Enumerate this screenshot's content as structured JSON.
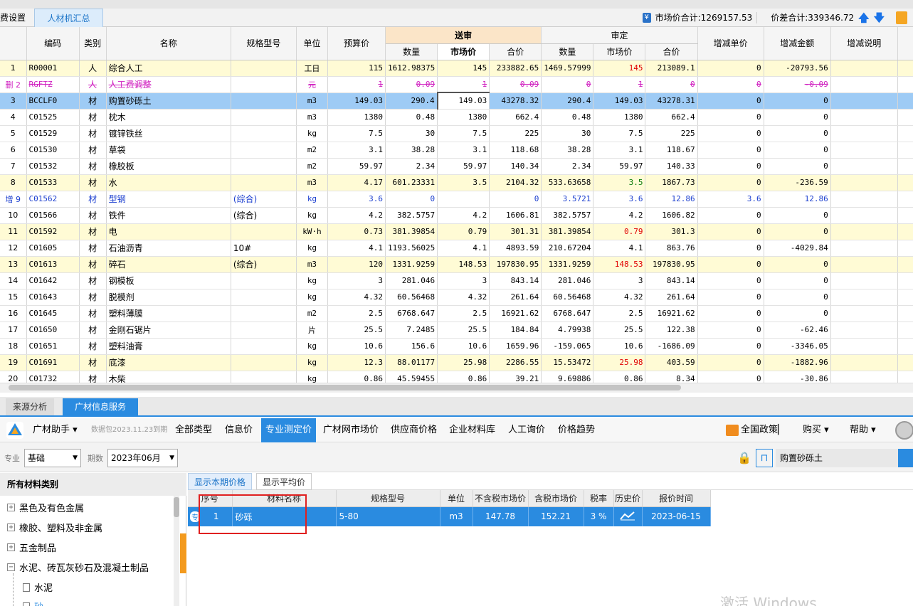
{
  "top_tabs": {
    "fees": "费设置",
    "summary": "人材机汇总"
  },
  "totals": {
    "market_total_label": "市场价合计:1269157.53",
    "price_diff_label": "价差合计:339346.72"
  },
  "grid": {
    "headers": {
      "code": "编码",
      "category": "类别",
      "name": "名称",
      "spec": "规格型号",
      "unit": "单位",
      "budget_price": "预算价",
      "songshen": "送审",
      "shending": "审定",
      "qty": "数量",
      "market_price": "市场价",
      "total": "合价",
      "delta_unit": "增减单价",
      "delta_amount": "增减金额",
      "delta_note": "增减说明"
    },
    "rows": [
      {
        "idx": "1",
        "code": "R00001",
        "cat": "人",
        "name": "综合人工",
        "spec": "",
        "unit": "工日",
        "budget": "115",
        "s_qty": "1612.98375",
        "s_mkt": "145",
        "s_total": "233882.65",
        "d_qty": "1469.57999",
        "d_mkt": "145",
        "d_total": "213089.1",
        "du": "0",
        "da": "-20793.56"
      },
      {
        "idx": "删 2",
        "code": "RGFTZ",
        "cat": "人",
        "name": "人工费调整",
        "spec": "",
        "unit": "元",
        "budget": "1",
        "s_qty": "0.09",
        "s_mkt": "1",
        "s_total": "0.09",
        "d_qty": "0",
        "d_mkt": "1",
        "d_total": "0",
        "du": "0",
        "da": "-0.09"
      },
      {
        "idx": "3",
        "code": "BCCLF0",
        "cat": "材",
        "name": "购置砂砾土",
        "spec": "",
        "unit": "m3",
        "budget": "149.03",
        "s_qty": "290.4",
        "s_mkt": "149.03",
        "s_total": "43278.32",
        "d_qty": "290.4",
        "d_mkt": "149.03",
        "d_total": "43278.31",
        "du": "0",
        "da": "0"
      },
      {
        "idx": "4",
        "code": "C01525",
        "cat": "材",
        "name": "枕木",
        "spec": "",
        "unit": "m3",
        "budget": "1380",
        "s_qty": "0.48",
        "s_mkt": "1380",
        "s_total": "662.4",
        "d_qty": "0.48",
        "d_mkt": "1380",
        "d_total": "662.4",
        "du": "0",
        "da": "0"
      },
      {
        "idx": "5",
        "code": "C01529",
        "cat": "材",
        "name": "镀锌铁丝",
        "spec": "",
        "unit": "kg",
        "budget": "7.5",
        "s_qty": "30",
        "s_mkt": "7.5",
        "s_total": "225",
        "d_qty": "30",
        "d_mkt": "7.5",
        "d_total": "225",
        "du": "0",
        "da": "0"
      },
      {
        "idx": "6",
        "code": "C01530",
        "cat": "材",
        "name": "草袋",
        "spec": "",
        "unit": "m2",
        "budget": "3.1",
        "s_qty": "38.28",
        "s_mkt": "3.1",
        "s_total": "118.68",
        "d_qty": "38.28",
        "d_mkt": "3.1",
        "d_total": "118.67",
        "du": "0",
        "da": "0"
      },
      {
        "idx": "7",
        "code": "C01532",
        "cat": "材",
        "name": "橡胶板",
        "spec": "",
        "unit": "m2",
        "budget": "59.97",
        "s_qty": "2.34",
        "s_mkt": "59.97",
        "s_total": "140.34",
        "d_qty": "2.34",
        "d_mkt": "59.97",
        "d_total": "140.33",
        "du": "0",
        "da": "0"
      },
      {
        "idx": "8",
        "code": "C01533",
        "cat": "材",
        "name": "水",
        "spec": "",
        "unit": "m3",
        "budget": "4.17",
        "s_qty": "601.23331",
        "s_mkt": "3.5",
        "s_total": "2104.32",
        "d_qty": "533.63658",
        "d_mkt": "3.5",
        "d_total": "1867.73",
        "du": "0",
        "da": "-236.59"
      },
      {
        "idx": "增 9",
        "code": "C01562",
        "cat": "材",
        "name": "型钢",
        "spec": "(综合)",
        "unit": "kg",
        "budget": "3.6",
        "s_qty": "0",
        "s_mkt": "",
        "s_total": "0",
        "d_qty": "3.5721",
        "d_mkt": "3.6",
        "d_total": "12.86",
        "du": "3.6",
        "da": "12.86"
      },
      {
        "idx": "10",
        "code": "C01566",
        "cat": "材",
        "name": "铁件",
        "spec": "(综合)",
        "unit": "kg",
        "budget": "4.2",
        "s_qty": "382.5757",
        "s_mkt": "4.2",
        "s_total": "1606.81",
        "d_qty": "382.5757",
        "d_mkt": "4.2",
        "d_total": "1606.82",
        "du": "0",
        "da": "0"
      },
      {
        "idx": "11",
        "code": "C01592",
        "cat": "材",
        "name": "电",
        "spec": "",
        "unit": "kW·h",
        "budget": "0.73",
        "s_qty": "381.39854",
        "s_mkt": "0.79",
        "s_total": "301.31",
        "d_qty": "381.39854",
        "d_mkt": "0.79",
        "d_total": "301.3",
        "du": "0",
        "da": "0"
      },
      {
        "idx": "12",
        "code": "C01605",
        "cat": "材",
        "name": "石油沥青",
        "spec": "10#",
        "unit": "kg",
        "budget": "4.1",
        "s_qty": "1193.56025",
        "s_mkt": "4.1",
        "s_total": "4893.59",
        "d_qty": "210.67204",
        "d_mkt": "4.1",
        "d_total": "863.76",
        "du": "0",
        "da": "-4029.84"
      },
      {
        "idx": "13",
        "code": "C01613",
        "cat": "材",
        "name": "碎石",
        "spec": "(综合)",
        "unit": "m3",
        "budget": "120",
        "s_qty": "1331.9259",
        "s_mkt": "148.53",
        "s_total": "197830.95",
        "d_qty": "1331.9259",
        "d_mkt": "148.53",
        "d_total": "197830.95",
        "du": "0",
        "da": "0"
      },
      {
        "idx": "14",
        "code": "C01642",
        "cat": "材",
        "name": "钢模板",
        "spec": "",
        "unit": "kg",
        "budget": "3",
        "s_qty": "281.046",
        "s_mkt": "3",
        "s_total": "843.14",
        "d_qty": "281.046",
        "d_mkt": "3",
        "d_total": "843.14",
        "du": "0",
        "da": "0"
      },
      {
        "idx": "15",
        "code": "C01643",
        "cat": "材",
        "name": "脱模剂",
        "spec": "",
        "unit": "kg",
        "budget": "4.32",
        "s_qty": "60.56468",
        "s_mkt": "4.32",
        "s_total": "261.64",
        "d_qty": "60.56468",
        "d_mkt": "4.32",
        "d_total": "261.64",
        "du": "0",
        "da": "0"
      },
      {
        "idx": "16",
        "code": "C01645",
        "cat": "材",
        "name": "塑料薄膜",
        "spec": "",
        "unit": "m2",
        "budget": "2.5",
        "s_qty": "6768.647",
        "s_mkt": "2.5",
        "s_total": "16921.62",
        "d_qty": "6768.647",
        "d_mkt": "2.5",
        "d_total": "16921.62",
        "du": "0",
        "da": "0"
      },
      {
        "idx": "17",
        "code": "C01650",
        "cat": "材",
        "name": "金刚石锯片",
        "spec": "",
        "unit": "片",
        "budget": "25.5",
        "s_qty": "7.2485",
        "s_mkt": "25.5",
        "s_total": "184.84",
        "d_qty": "4.79938",
        "d_mkt": "25.5",
        "d_total": "122.38",
        "du": "0",
        "da": "-62.46"
      },
      {
        "idx": "18",
        "code": "C01651",
        "cat": "材",
        "name": "塑料油膏",
        "spec": "",
        "unit": "kg",
        "budget": "10.6",
        "s_qty": "156.6",
        "s_mkt": "10.6",
        "s_total": "1659.96",
        "d_qty": "-159.065",
        "d_mkt": "10.6",
        "d_total": "-1686.09",
        "du": "0",
        "da": "-3346.05"
      },
      {
        "idx": "19",
        "code": "C01691",
        "cat": "材",
        "name": "底漆",
        "spec": "",
        "unit": "kg",
        "budget": "12.3",
        "s_qty": "88.01177",
        "s_mkt": "25.98",
        "s_total": "2286.55",
        "d_qty": "15.53472",
        "d_mkt": "25.98",
        "d_total": "403.59",
        "du": "0",
        "da": "-1882.96"
      },
      {
        "idx": "20",
        "code": "C01732",
        "cat": "材",
        "name": "木柴",
        "spec": "",
        "unit": "kg",
        "budget": "0.86",
        "s_qty": "45.59455",
        "s_mkt": "0.86",
        "s_total": "39.21",
        "d_qty": "9.69886",
        "d_mkt": "0.86",
        "d_total": "8.34",
        "du": "0",
        "da": "-30.86"
      }
    ]
  },
  "bottom_tabs": {
    "source": "来源分析",
    "gc_info": "广材信息服务"
  },
  "toolbar": {
    "assistant": "广材助手",
    "data_note": "数据包2023.11.23到期",
    "items": [
      "全部类型",
      "信息价",
      "专业测定价",
      "广材网市场价",
      "供应商价格",
      "企业材料库",
      "人工询价",
      "价格趋势"
    ],
    "policy": "全国政策",
    "buy": "购买",
    "help": "帮助"
  },
  "filters": {
    "specialty_label": "专业",
    "specialty_value": "基础",
    "period_label": "期数",
    "period_value": "2023年06月",
    "search_value": "购置砂砾土"
  },
  "tree": {
    "header": "所有材料类别",
    "items": [
      "黑色及有色金属",
      "橡胶、塑料及非金属",
      "五金制品",
      "水泥、砖瓦灰砂石及混凝土制品",
      "水泥",
      "砂"
    ]
  },
  "price_panel": {
    "subtab_current": "显示本期价格",
    "subtab_avg": "显示平均价",
    "headers": [
      "序号",
      "材料名称",
      "规格型号",
      "单位",
      "不含税市场价",
      "含税市场价",
      "税率",
      "历史价",
      "报价时间"
    ],
    "row": {
      "badge": "专",
      "seq": "1",
      "name": "砂砾",
      "spec": "5-80",
      "unit": "m3",
      "price_ex_tax": "147.78",
      "price_inc_tax": "152.21",
      "tax": "3 %",
      "date": "2023-06-15"
    }
  },
  "watermark": "激活 Windows",
  "colors": {
    "accent": "#2a8be0",
    "yellow_row": "#fffbd5",
    "selected_row": "#9ecbf5",
    "deleted": "#d020c0",
    "added": "#1c3fcf",
    "highlight_red": "#e00000",
    "highlight_green": "#0a7a0a",
    "annotation_box": "#e02020"
  }
}
